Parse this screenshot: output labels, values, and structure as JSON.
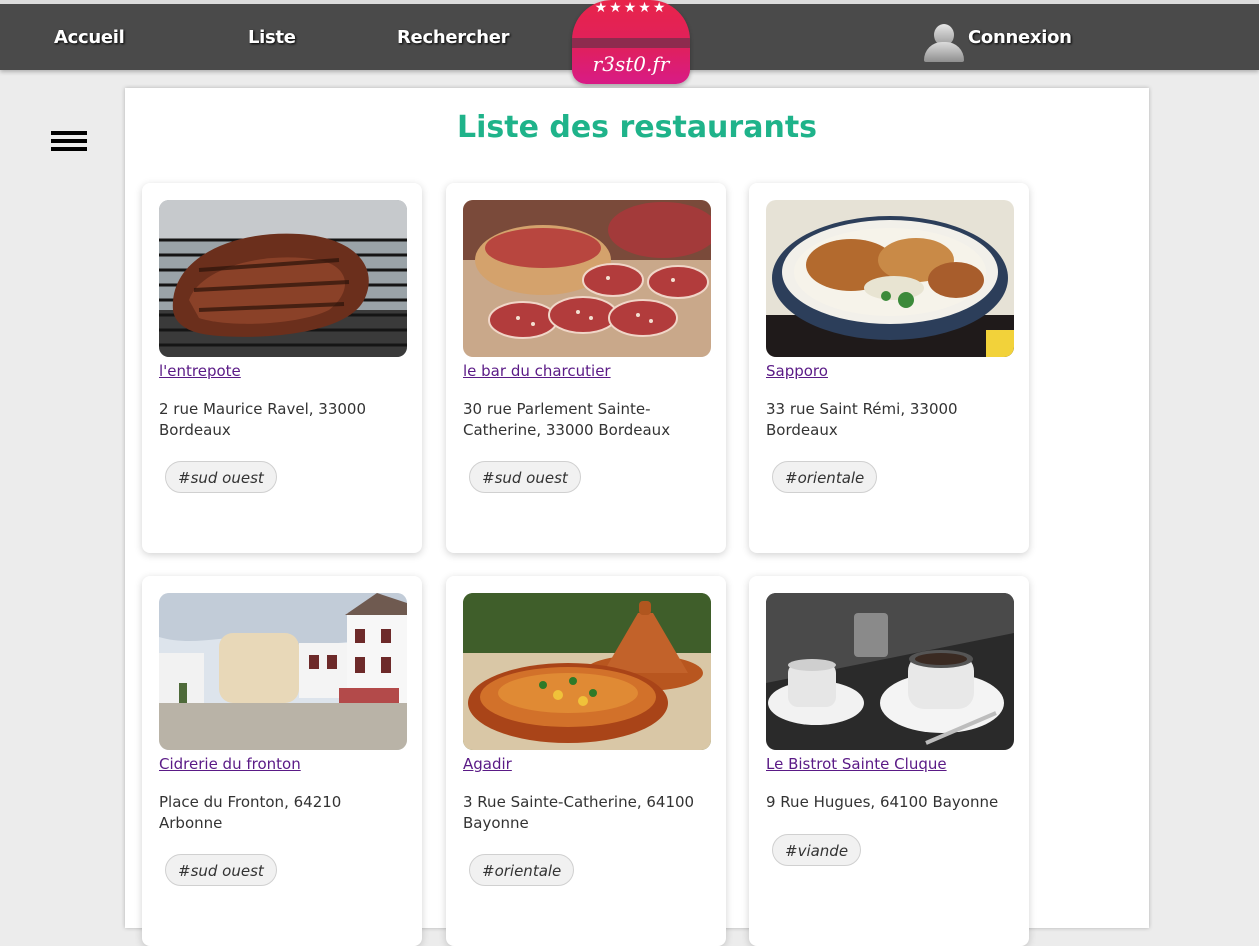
{
  "nav": {
    "home": "Accueil",
    "list": "Liste",
    "search": "Rechercher",
    "login": "Connexion"
  },
  "logo": {
    "stars": "★★★★★",
    "brand": "r3st0.fr"
  },
  "page": {
    "title": "Liste des restaurants"
  },
  "colors": {
    "topbar": "#4a4a4a",
    "title": "#1fb38a",
    "link": "#5a1a86",
    "logo": "#e0205c"
  },
  "restaurants": [
    {
      "name": "l'entrepote",
      "address": "2 rue Maurice Ravel, 33000 Bordeaux",
      "tags": [
        "#sud ouest"
      ],
      "image": "grilled-steak"
    },
    {
      "name": "le bar du charcutier",
      "address": "30 rue Parlement Sainte-Catherine, 33000 Bordeaux",
      "tags": [
        "#sud ouest"
      ],
      "image": "charcuterie"
    },
    {
      "name": "Sapporo",
      "address": "33 rue Saint Rémi, 33000 Bordeaux",
      "tags": [
        "#orientale"
      ],
      "image": "rice-bowl"
    },
    {
      "name": "Cidrerie du fronton",
      "address": "Place du Fronton, 64210 Arbonne",
      "tags": [
        "#sud ouest"
      ],
      "image": "fronton-building"
    },
    {
      "name": "Agadir",
      "address": "3 Rue Sainte-Catherine, 64100 Bayonne",
      "tags": [
        "#orientale"
      ],
      "image": "tajine"
    },
    {
      "name": "Le Bistrot Sainte Cluque",
      "address": "9 Rue Hugues, 64100 Bayonne",
      "tags": [
        "#viande"
      ],
      "image": "coffee-cups"
    }
  ]
}
